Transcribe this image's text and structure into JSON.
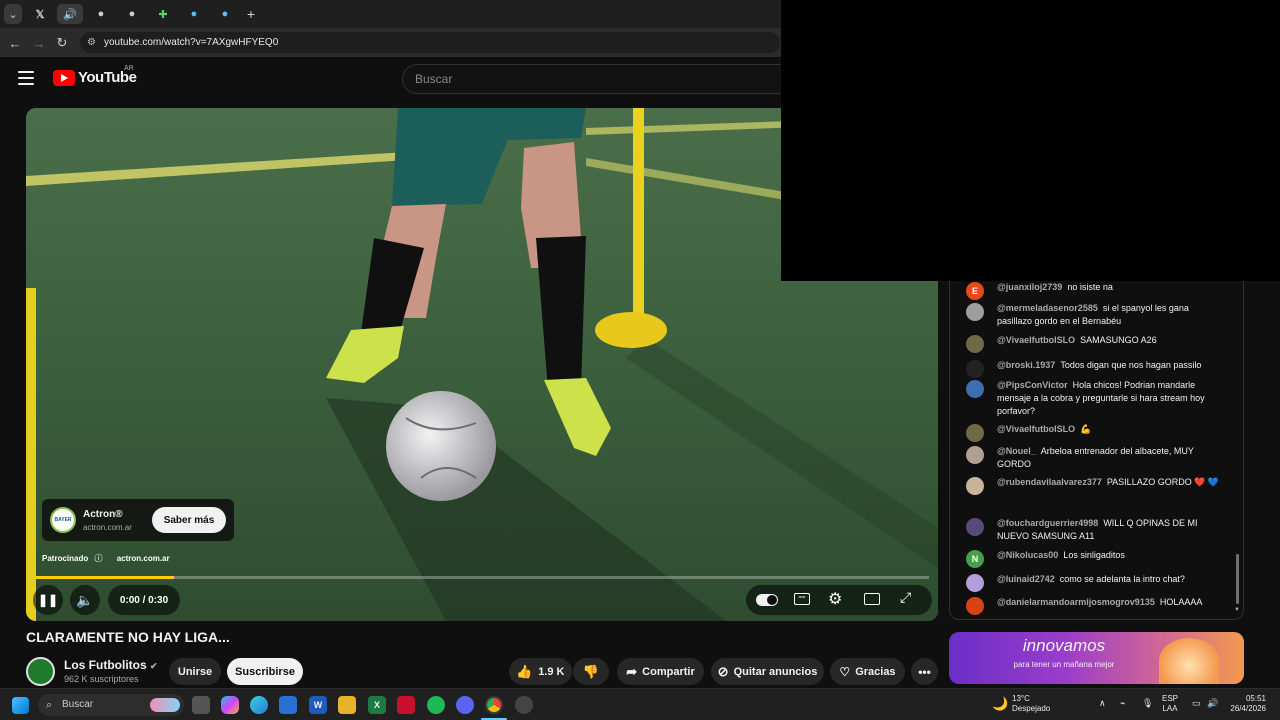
{
  "browser": {
    "url": "youtube.com/watch?v=7AXgwHFYEQ0",
    "tab_icons": [
      "chevron-down-icon",
      "x-logo-icon",
      "audio-icon",
      "tab-icon",
      "tab-icon",
      "extension-icon",
      "tab-icon",
      "tab-icon"
    ],
    "new_tab": "+"
  },
  "header": {
    "logo_text": "YouTube",
    "country_code": "AR",
    "search_placeholder": "Buscar"
  },
  "player": {
    "ad": {
      "title": "Actron®",
      "domain": "actron.com.ar",
      "cta": "Saber más",
      "sponsored_label": "Patrocinado",
      "sponsored_domain": "actron.com.ar",
      "logo_text": "BAYER"
    },
    "time": "0:00 / 0:30",
    "progress": 0.155
  },
  "video": {
    "title": "CLARAMENTE NO HAY LIGA...",
    "channel": "Los Futbolitos",
    "subscribers": "962 K suscriptores",
    "join_label": "Unirse",
    "subscribe_label": "Suscribirse",
    "likes": "1.9 K",
    "share_label": "Compartir",
    "remove_ads_label": "Quitar anuncios",
    "thanks_label": "Gracias"
  },
  "chat": {
    "messages": [
      {
        "author": "@juanxiloj2739",
        "text": "no isiste na",
        "avatar": "E",
        "color": "#e64a19"
      },
      {
        "author": "@mermeladasenor2585",
        "text": "si el spanyol les gana pasillazo gordo en el Bernabéu",
        "avatar": "",
        "color": "#9e9e9e"
      },
      {
        "author": "@VivaelfutbolSLO",
        "text": "SAMASUNGO A26",
        "avatar": "",
        "color": "#6d6a45"
      },
      {
        "author": "@broski.1937",
        "text": "Todos digan que nos hagan passilo",
        "avatar": "",
        "color": "#222222"
      },
      {
        "author": "@PipsConVictor",
        "text": "Hola chicos! Podrian mandarle mensaje a la cobra y preguntarle si hara stream hoy porfavor?",
        "avatar": "",
        "color": "#3b6fb0"
      },
      {
        "author": "@VivaelfutbolSLO",
        "text": "💪",
        "avatar": "",
        "color": "#6d6a45"
      },
      {
        "author": "@Nouel_",
        "text": "Arbeloa entrenador del albacete, MUY GORDO",
        "avatar": "",
        "color": "#b0a090"
      },
      {
        "author": "@rubendavilaalvarez377",
        "text": "PASILLAZO GORDO ❤️ 💙",
        "avatar": "",
        "color": "#c9b49a"
      },
      {
        "author": "@fouchardguerrier4998",
        "text": "WILL Q OPINAS DE MI NUEVO SAMSUNG A11",
        "avatar": "",
        "color": "#5a4a7a"
      },
      {
        "author": "@Nikolucas00",
        "text": "Los sinligaditos",
        "avatar": "N",
        "color": "#43a047"
      },
      {
        "author": "@luinaid2742",
        "text": "como se adelanta la intro chat?",
        "avatar": "",
        "color": "#b39ddb"
      },
      {
        "author": "@danielarmandoarmijosmogrov9135",
        "text": "HOLAAAA",
        "avatar": "",
        "color": "#d84315"
      }
    ]
  },
  "banner": {
    "headline": "innovamos",
    "subline": "para tener un mañana mejor"
  },
  "taskbar": {
    "search_placeholder": "Buscar",
    "weather_temp": "13°C",
    "weather_desc": "Despejado",
    "lang": "ESP",
    "layout": "LAA",
    "time": "05:51",
    "date": "26/4/2026"
  }
}
